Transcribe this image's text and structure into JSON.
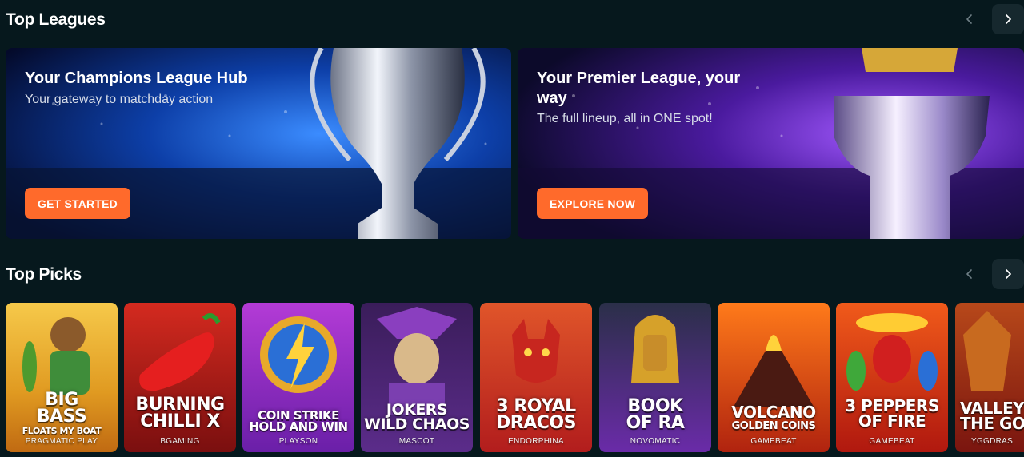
{
  "leagues_section": {
    "title": "Top Leagues",
    "prev_icon": "chevron-left-icon",
    "next_icon": "chevron-right-icon"
  },
  "banners": [
    {
      "title": "Your Champions League Hub",
      "subtitle": "Your gateway to matchday action",
      "cta": "GET STARTED",
      "accent": "#1f5bd6"
    },
    {
      "title": "Your Premier League, your way",
      "subtitle": "The full lineup, all in ONE spot!",
      "cta": "EXPLORE NOW",
      "accent": "#7a2cd6"
    }
  ],
  "picks_section": {
    "title": "Top Picks",
    "prev_icon": "chevron-left-icon",
    "next_icon": "chevron-right-icon"
  },
  "games": [
    {
      "title_line1": "BIG",
      "title_line2": "BASS",
      "title_line3": "FLOATS MY BOAT",
      "provider": "PRAGMATIC PLAY"
    },
    {
      "title_line1": "BURNING",
      "title_line2": "CHILLI X",
      "provider": "BGAMING"
    },
    {
      "title_line1": "COIN STRIKE",
      "title_line2": "HOLD AND WIN",
      "provider": "PLAYSON"
    },
    {
      "title_line1": "JOKERS",
      "title_line2": "WILD CHAOS",
      "provider": "MASCOT"
    },
    {
      "title_line1": "3 ROYAL",
      "title_line2": "DRACOS",
      "provider": "ENDORPHINA"
    },
    {
      "title_line1": "BOOK",
      "title_line2": "OF RA",
      "provider": "NOVOMATIC"
    },
    {
      "title_line1": "VOLCANO",
      "title_line2": "GOLDEN COINS",
      "provider": "GAMEBEAT"
    },
    {
      "title_line1": "3 PEPPERS",
      "title_line2": "OF FIRE",
      "provider": "GAMEBEAT"
    },
    {
      "title_line1": "VALLEY",
      "title_line2": "THE GO",
      "provider": "YGGDRAS"
    }
  ],
  "colors": {
    "background": "#06181d",
    "cta": "#ff6a2b",
    "nav_button": "#16282e"
  }
}
